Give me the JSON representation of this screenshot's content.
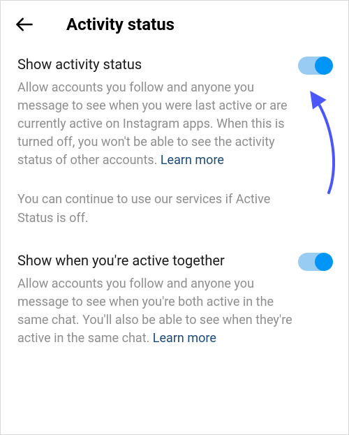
{
  "header": {
    "title": "Activity status"
  },
  "settings": {
    "activity_status": {
      "title": "Show activity status",
      "description": "Allow accounts you follow and anyone you message to see when you were last active or are currently active on Instagram apps. When this is turned off, you won't be able to see the activity status of other accounts. ",
      "learn_more": "Learn more",
      "enabled": true
    },
    "sub_note": "You can continue to use our services if Active Status is off.",
    "active_together": {
      "title": "Show when you're active together",
      "description": "Allow accounts you follow and anyone you message to see when you're both active in the same chat. You'll also be able to see when they're active in the same chat. ",
      "learn_more": "Learn more",
      "enabled": true
    }
  },
  "colors": {
    "accent": "#0095f6",
    "link": "#1c4a7a",
    "text_secondary": "#8e8e8e",
    "annotation": "#4b56ff"
  }
}
